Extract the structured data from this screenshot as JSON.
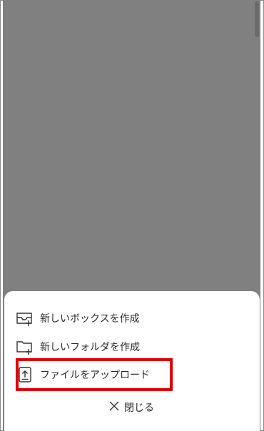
{
  "sheet": {
    "items": [
      {
        "label": "新しいボックスを作成",
        "icon": "new-box-icon"
      },
      {
        "label": "新しいフォルダを作成",
        "icon": "new-folder-icon"
      },
      {
        "label": "ファイルをアップロード",
        "icon": "upload-icon"
      }
    ],
    "close_label": "閉じる",
    "close_icon": "close-icon"
  },
  "colors": {
    "overlay": "#808080",
    "highlight": "#e00000",
    "text": "#2b2b2b"
  }
}
